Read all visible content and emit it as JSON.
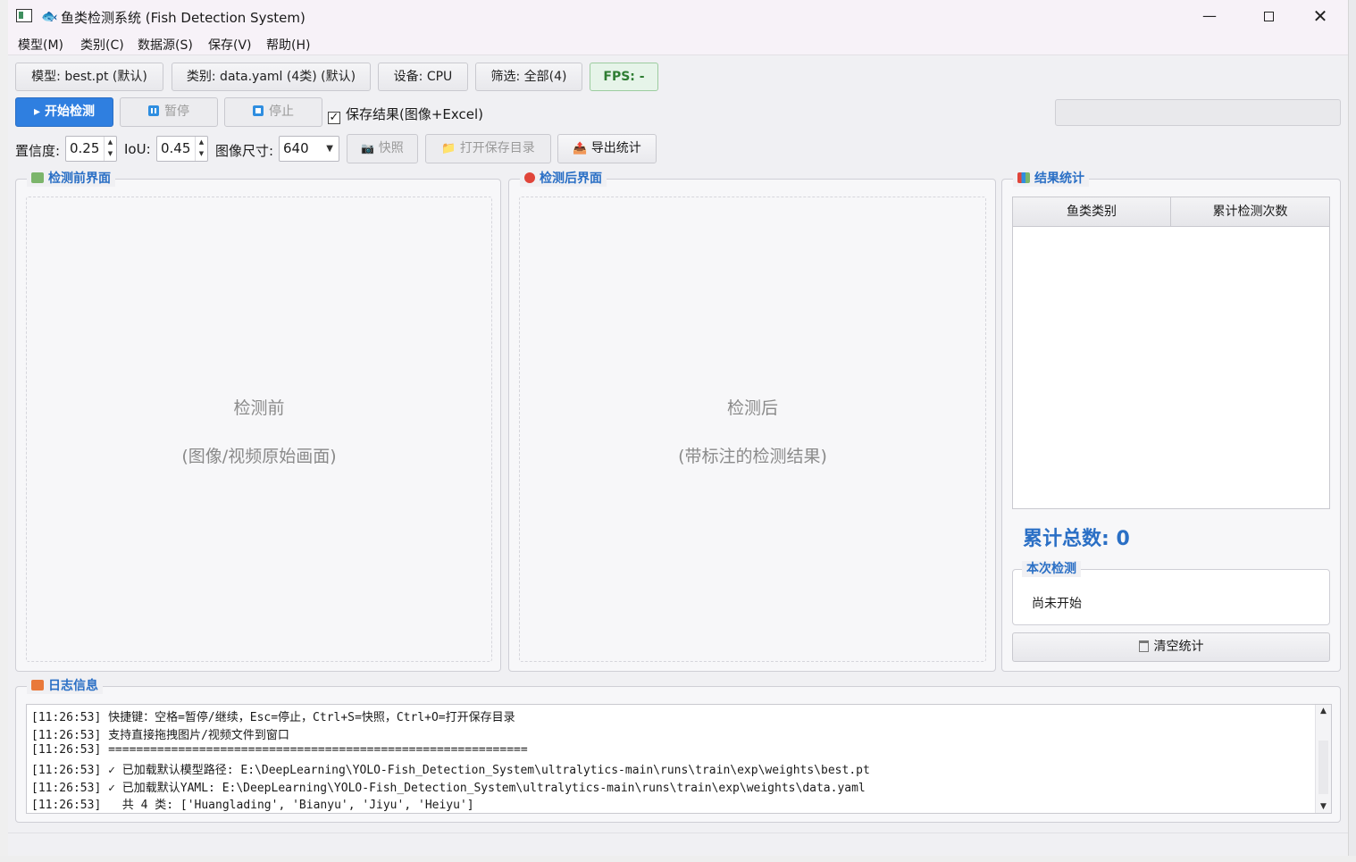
{
  "window": {
    "title": "鱼类检测系统 (Fish Detection System)",
    "controls": {
      "minimize": "—",
      "maximize": "",
      "close": "✕"
    }
  },
  "menu": [
    "模型(M)",
    "类别(C)",
    "数据源(S)",
    "保存(V)",
    "帮助(H)"
  ],
  "info_bar": {
    "model": "模型: best.pt (默认)",
    "classes": "类别: data.yaml (4类) (默认)",
    "device": "设备: CPU",
    "filter": "筛选: 全部(4)",
    "fps": "FPS: -"
  },
  "actions": {
    "start": "开始检测",
    "start_icon": "▸",
    "pause": "暂停",
    "stop": "停止",
    "save_checkbox_label": "保存结果(图像+Excel)",
    "save_checked": true,
    "check_mark": "✓",
    "snapshot": "快照",
    "open_dir": "打开保存目录",
    "export_stats": "导出统计"
  },
  "params": {
    "conf_label": "置信度:",
    "conf_value": "0.25",
    "iou_label": "IoU:",
    "iou_value": "0.45",
    "imgsz_label": "图像尺寸:",
    "imgsz_value": "640"
  },
  "panels": {
    "before": {
      "title": "检测前界面",
      "line1": "检测前",
      "line2": "(图像/视频原始画面)"
    },
    "after": {
      "title": "检测后界面",
      "line1": "检测后",
      "line2": "(带标注的检测结果)"
    }
  },
  "stats": {
    "title": "结果统计",
    "columns": [
      "鱼类类别",
      "累计检测次数"
    ],
    "rows": [],
    "total": "累计总数: 0",
    "current_title": "本次检测",
    "current_status": "尚未开始",
    "clear": "清空统计"
  },
  "log": {
    "title": "日志信息",
    "lines": [
      "[11:26:53] 快捷键：空格=暂停/继续，Esc=停止，Ctrl+S=快照，Ctrl+O=打开保存目录",
      "[11:26:53] 支持直接拖拽图片/视频文件到窗口",
      "[11:26:53] ============================================================",
      "[11:26:53] ✓ 已加载默认模型路径: E:\\DeepLearning\\YOLO-Fish_Detection_System\\ultralytics-main\\runs\\train\\exp\\weights\\best.pt",
      "[11:26:53] ✓ 已加载默认YAML: E:\\DeepLearning\\YOLO-Fish_Detection_System\\ultralytics-main\\runs\\train\\exp\\weights\\data.yaml",
      "[11:26:53]   共 4 类: ['Huanglading', 'Bianyu', 'Jiyu', 'Heiyu']"
    ]
  },
  "colors": {
    "accent": "#2f7fe0",
    "title_blue": "#2a6fc5",
    "fps_green": "#2e7d32"
  }
}
